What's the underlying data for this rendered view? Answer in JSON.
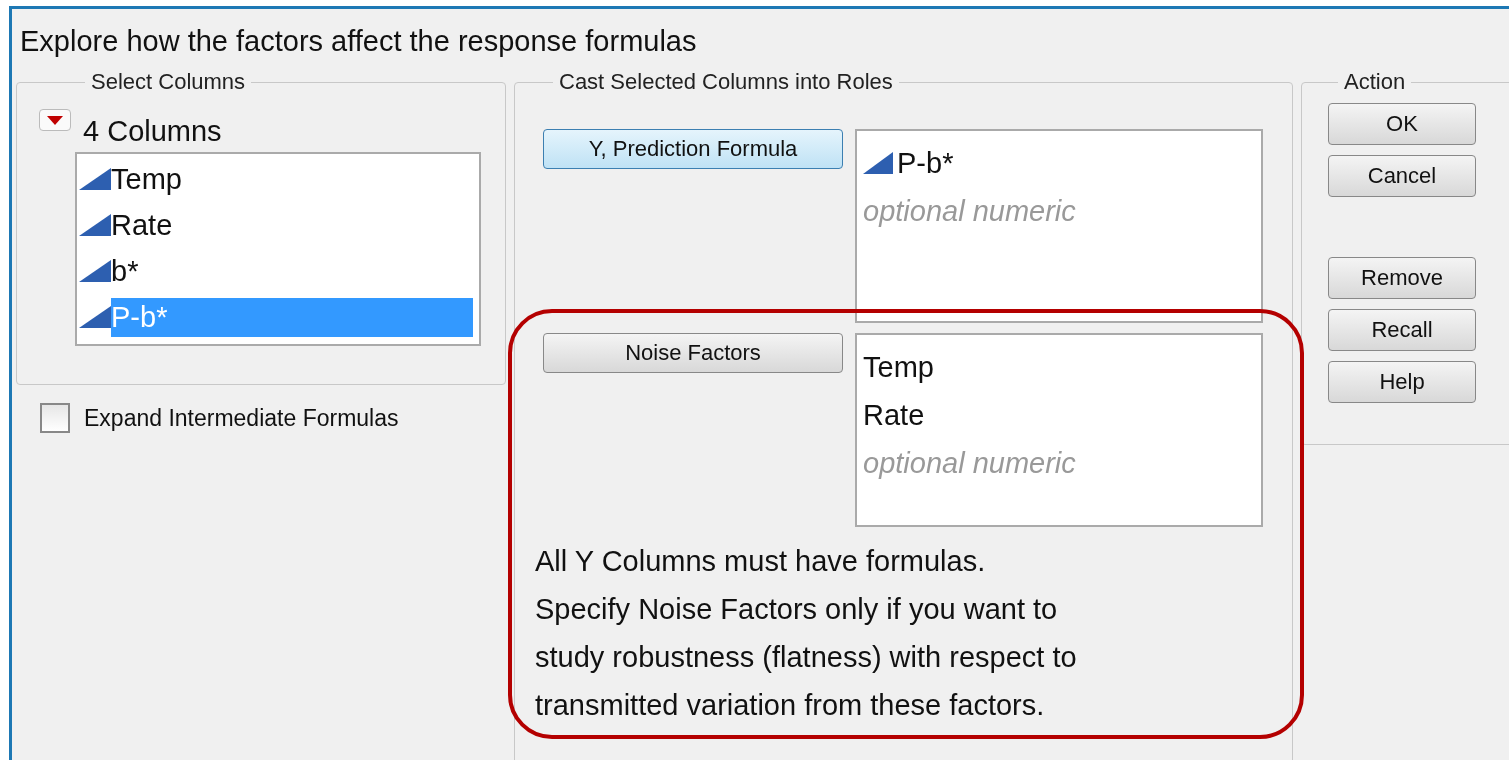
{
  "heading": "Explore how the factors affect the response formulas",
  "select_columns": {
    "title": "Select Columns",
    "count": "4 Columns",
    "columns": [
      {
        "name": "Temp",
        "selected": false
      },
      {
        "name": "Rate",
        "selected": false
      },
      {
        "name": "b*",
        "selected": false
      },
      {
        "name": "P-b*",
        "selected": true
      }
    ]
  },
  "expand_intermediate": {
    "label": "Expand Intermediate Formulas",
    "checked": false
  },
  "roles": {
    "title": "Cast Selected Columns into Roles",
    "items": [
      {
        "button": "Y, Prediction Formula",
        "highlighted": true,
        "entries": [
          {
            "name": "P-b*",
            "kind": "column"
          }
        ],
        "placeholder": "optional numeric"
      },
      {
        "button": "Noise Factors",
        "highlighted": false,
        "entries": [
          {
            "name": "Temp",
            "kind": "plain"
          },
          {
            "name": "Rate",
            "kind": "plain"
          }
        ],
        "placeholder": "optional numeric"
      }
    ],
    "note": [
      "All Y Columns must have formulas.",
      "Specify Noise Factors only if you want to",
      "study robustness (flatness) with respect to",
      "transmitted variation from these factors."
    ]
  },
  "action": {
    "title": "Action",
    "buttons_top": [
      "OK",
      "Cancel"
    ],
    "buttons_bottom": [
      "Remove",
      "Recall",
      "Help"
    ]
  }
}
